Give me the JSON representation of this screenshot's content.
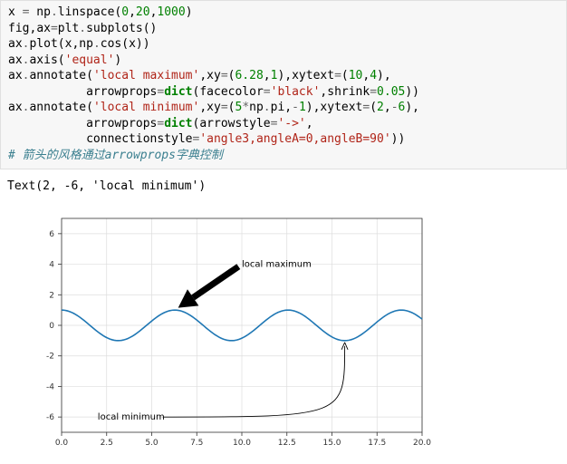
{
  "code": {
    "l1a": "x ",
    "l1b": "=",
    "l1c": " np",
    "l1d": ".",
    "l1e": "linspace",
    "l1f": "(",
    "l1g": "0",
    "l1h": ",",
    "l1i": "20",
    "l1j": ",",
    "l1k": "1000",
    "l1l": ")",
    "l2a": "fig",
    "l2b": ",",
    "l2c": "ax",
    "l2d": "=",
    "l2e": "plt",
    "l2f": ".",
    "l2g": "subplots",
    "l2h": "()",
    "l3a": "ax",
    "l3b": ".",
    "l3c": "plot",
    "l3d": "(x,np",
    "l3e": ".",
    "l3f": "cos",
    "l3g": "(x))",
    "l4a": "ax",
    "l4b": ".",
    "l4c": "axis",
    "l4d": "(",
    "l4e": "'equal'",
    "l4f": ")",
    "l5a": "ax",
    "l5b": ".",
    "l5c": "annotate",
    "l5d": "(",
    "l5e": "'local maximum'",
    "l5f": ",xy",
    "l5g": "=",
    "l5h": "(",
    "l5i": "6.28",
    "l5j": ",",
    "l5k": "1",
    "l5l": "),xytext",
    "l5m": "=",
    "l5n": "(",
    "l5o": "10",
    "l5p": ",",
    "l5q": "4",
    "l5r": "),",
    "l6a": "           arrowprops",
    "l6b": "=",
    "l6c": "dict",
    "l6d": "(facecolor",
    "l6e": "=",
    "l6f": "'black'",
    "l6g": ",shrink",
    "l6h": "=",
    "l6i": "0.05",
    "l6j": "))",
    "l7a": "ax",
    "l7b": ".",
    "l7c": "annotate",
    "l7d": "(",
    "l7e": "'local minimum'",
    "l7f": ",xy",
    "l7g": "=",
    "l7h": "(",
    "l7i": "5",
    "l7j": "*",
    "l7k": "np",
    "l7l": ".",
    "l7m": "pi,",
    "l7n": "-",
    "l7o": "1",
    "l7p": "),xytext",
    "l7q": "=",
    "l7r": "(",
    "l7s": "2",
    "l7t": ",",
    "l7u": "-",
    "l7v": "6",
    "l7w": "),",
    "l8a": "           arrowprops",
    "l8b": "=",
    "l8c": "dict",
    "l8d": "(arrowstyle",
    "l8e": "=",
    "l8f": "'->'",
    "l8g": ",",
    "l9a": "           connectionstyle",
    "l9b": "=",
    "l9c": "'angle3,angleA=0,angleB=90'",
    "l9d": "))",
    "l10": "# 箭头的风格通过arrowprops字典控制"
  },
  "output": {
    "repr": "Text(2, -6, 'local minimum')"
  },
  "chart_data": {
    "type": "line",
    "title": "",
    "xlabel": "",
    "ylabel": "",
    "xlim": [
      0,
      20
    ],
    "ylim": [
      -7,
      7
    ],
    "xticks": [
      0.0,
      2.5,
      5.0,
      7.5,
      10.0,
      12.5,
      15.0,
      17.5,
      20.0
    ],
    "yticks": [
      -6,
      -4,
      -2,
      0,
      2,
      4,
      6
    ],
    "series": [
      {
        "name": "cos(x)",
        "kind": "function",
        "expr": "cos(x)",
        "samples": 1000
      }
    ],
    "annotations": [
      {
        "text": "local maximum",
        "xy": [
          6.28,
          1
        ],
        "xytext": [
          10,
          4
        ],
        "arrow": "thick-black",
        "shrink": 0.05
      },
      {
        "text": "local minimum",
        "xy": [
          15.708,
          -1
        ],
        "xytext": [
          2,
          -6
        ],
        "arrow": "->",
        "connectionstyle": "angle3,angleA=0,angleB=90"
      }
    ],
    "tick_labels": {
      "x": [
        "0.0",
        "2.5",
        "5.0",
        "7.5",
        "10.0",
        "12.5",
        "15.0",
        "17.5",
        "20.0"
      ],
      "y": [
        "-6",
        "-4",
        "-2",
        "0",
        "2",
        "4",
        "6"
      ]
    }
  }
}
